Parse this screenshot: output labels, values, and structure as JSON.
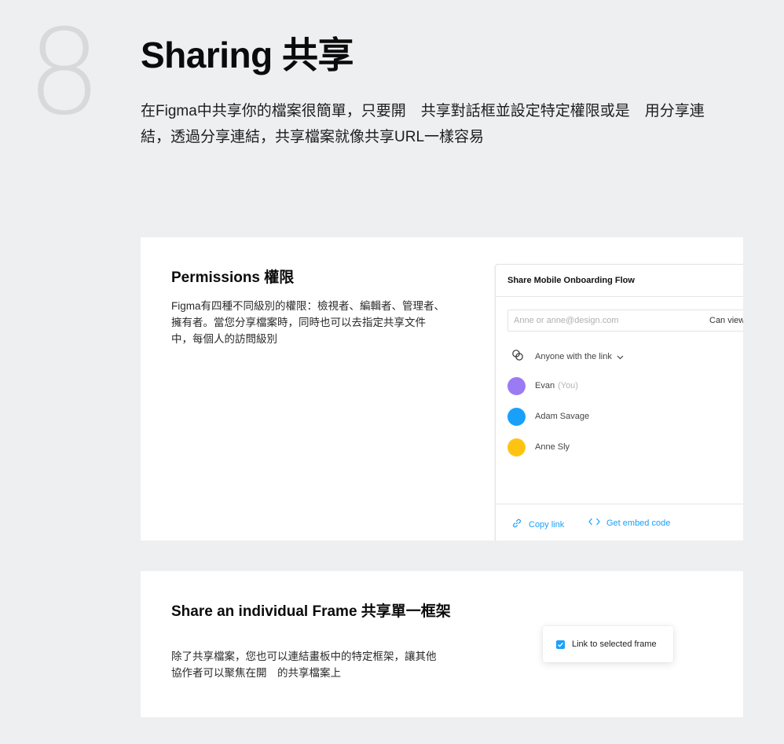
{
  "section": {
    "number": "8",
    "title": "Sharing 共享",
    "intro": "在Figma中共享你的檔案很簡單，只要開　共享對話框並設定特定權限或是　用分享連結，透過分享連結，共享檔案就像共享URL一樣容易"
  },
  "permissions": {
    "heading": "Permissions 權限",
    "body": "Figma有四種不同級別的權限：檢視者、編輯者、管理者、擁有者。當您分享檔案時，同時也可以去指定共享文件中，每個人的訪問級別"
  },
  "share_dialog": {
    "title": "Share Mobile Onboarding Flow",
    "email_placeholder": "Anne or anne@design.com",
    "permission_select": "Can view",
    "link_access": "Anyone with the link",
    "people": [
      {
        "name": "Evan",
        "suffix": "(You)",
        "color": "#9a7bf4"
      },
      {
        "name": "Adam Savage",
        "suffix": "",
        "color": "#18a0fb"
      },
      {
        "name": "Anne Sly",
        "suffix": "",
        "color": "#ffc412"
      }
    ],
    "copy_link": "Copy link",
    "embed_code": "Get embed code"
  },
  "frame_share": {
    "heading": "Share an individual Frame 共享單一框架",
    "body": "除了共享檔案，您也可以連結畫板中的特定框架，讓其他協作者可以聚焦在開　的共享檔案上",
    "checkbox_label": "Link to selected frame",
    "checkbox_checked": true
  },
  "colors": {
    "accent": "#18a0fb",
    "background": "#eeeff1",
    "number": "#d8d9dc"
  },
  "icons": [
    "link-access-icon",
    "chevron-down-icon",
    "copy-link-icon",
    "embed-code-icon",
    "checkmark-icon"
  ]
}
